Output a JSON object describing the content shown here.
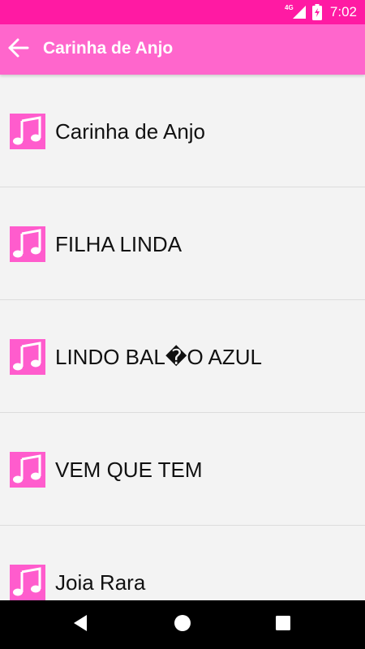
{
  "status_bar": {
    "time": "7:02",
    "network": "4G",
    "color": "#ff1aa3",
    "icons": [
      "signal-icon",
      "battery-charging-icon"
    ]
  },
  "app_bar": {
    "title": "Carinha de Anjo",
    "back_icon": "arrow-left-icon",
    "color": "#ff66cc"
  },
  "songs": [
    {
      "title": "Carinha de Anjo",
      "icon": "music-note-icon"
    },
    {
      "title": "FILHA LINDA",
      "icon": "music-note-icon"
    },
    {
      "title": "LINDO BAL�O AZUL",
      "icon": "music-note-icon"
    },
    {
      "title": "VEM QUE TEM",
      "icon": "music-note-icon"
    },
    {
      "title": "Joia Rara",
      "icon": "music-note-icon"
    }
  ],
  "nav_bar": {
    "icons": [
      "back-triangle-icon",
      "home-circle-icon",
      "recents-square-icon"
    ]
  },
  "colors": {
    "icon_pink": "#ff5ccd",
    "list_background": "#f3f3f3",
    "divider": "#dcdcdc"
  }
}
